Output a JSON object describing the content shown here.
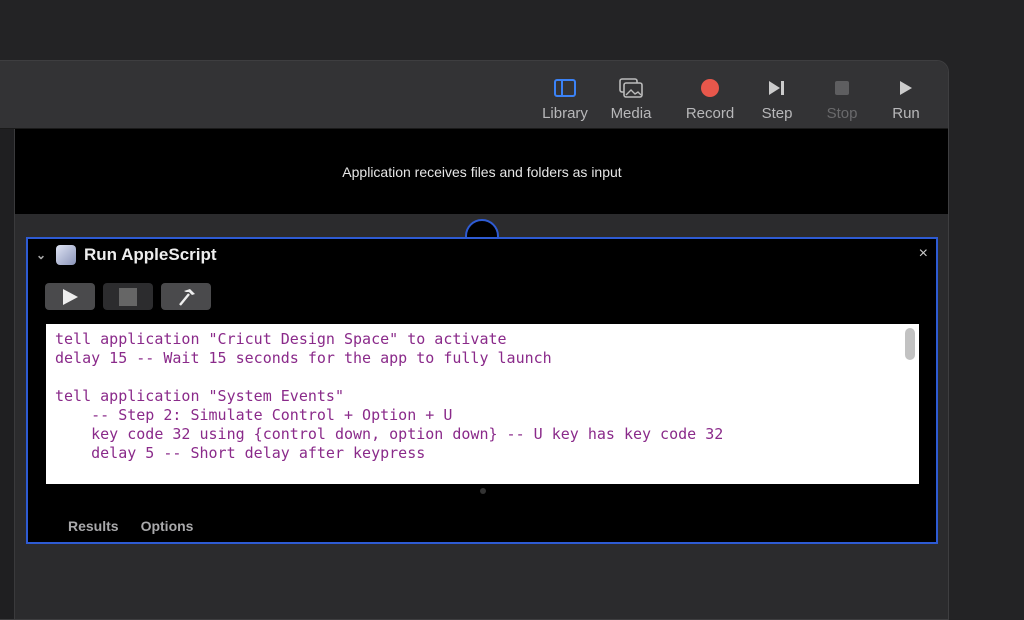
{
  "toolbar": {
    "items": [
      {
        "label": "Library",
        "icon": "sidebar-icon"
      },
      {
        "label": "Media",
        "icon": "photos-icon"
      },
      {
        "label": "Record",
        "icon": "record-icon"
      },
      {
        "label": "Step",
        "icon": "step-icon"
      },
      {
        "label": "Stop",
        "icon": "stop-icon"
      },
      {
        "label": "Run",
        "icon": "play-icon"
      }
    ]
  },
  "banner": "Application receives files and folders as input",
  "action": {
    "title": "Run AppleScript",
    "close": "×",
    "code": "tell application \"Cricut Design Space\" to activate\ndelay 15 -- Wait 15 seconds for the app to fully launch\n\ntell application \"System Events\"\n    -- Step 2: Simulate Control + Option + U\n    key code 32 using {control down, option down} -- U key has key code 32\n    delay 5 -- Short delay after keypress",
    "tabs": [
      "Results",
      "Options"
    ]
  },
  "colors": {
    "accent": "#2e5bd3",
    "record": "#e8574b",
    "code": "#8a2a8a"
  }
}
